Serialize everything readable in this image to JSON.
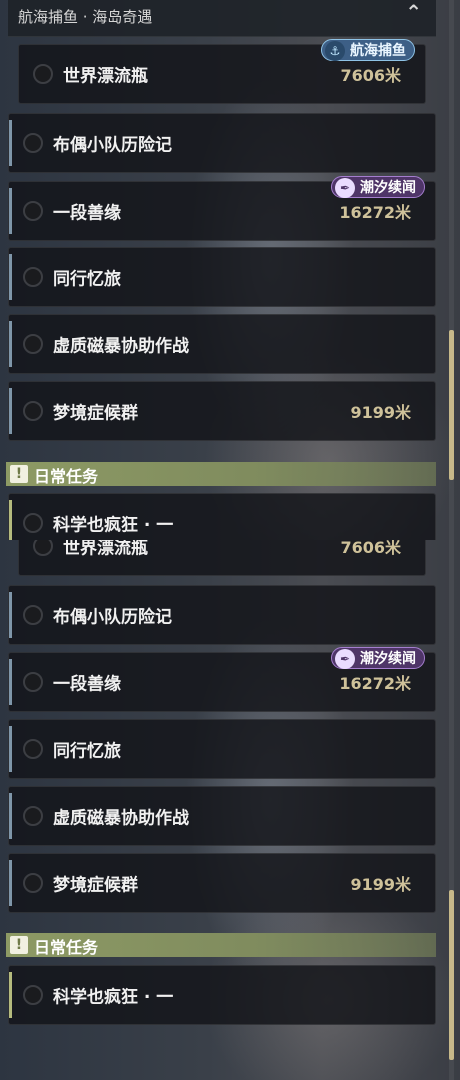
{
  "header": {
    "subtitle": "航海捕鱼 · 海岛奇遇",
    "chevron_icon": "chevron-up-icon"
  },
  "tags": {
    "sea_fishing": "航海捕鱼",
    "tide_story": "潮汐续闻"
  },
  "quests": [
    {
      "label": "世界漂流瓶",
      "distance": "7606米"
    },
    {
      "label": "布偶小队历险记",
      "distance": ""
    },
    {
      "label": "一段善缘",
      "distance": "16272米"
    },
    {
      "label": "同行忆旅",
      "distance": ""
    },
    {
      "label": "虚质磁暴协助作战",
      "distance": ""
    },
    {
      "label": "梦境症候群",
      "distance": "9199米"
    }
  ],
  "daily": {
    "title": "日常任务",
    "icon_glyph": "!",
    "quests": [
      {
        "label": "科学也疯狂 · 一"
      }
    ]
  },
  "colors": {
    "accent_daily": "#8d9a64",
    "distance": "#cfc29a",
    "tag_sea": "#3d5f86",
    "tag_tide": "#4f3568"
  }
}
